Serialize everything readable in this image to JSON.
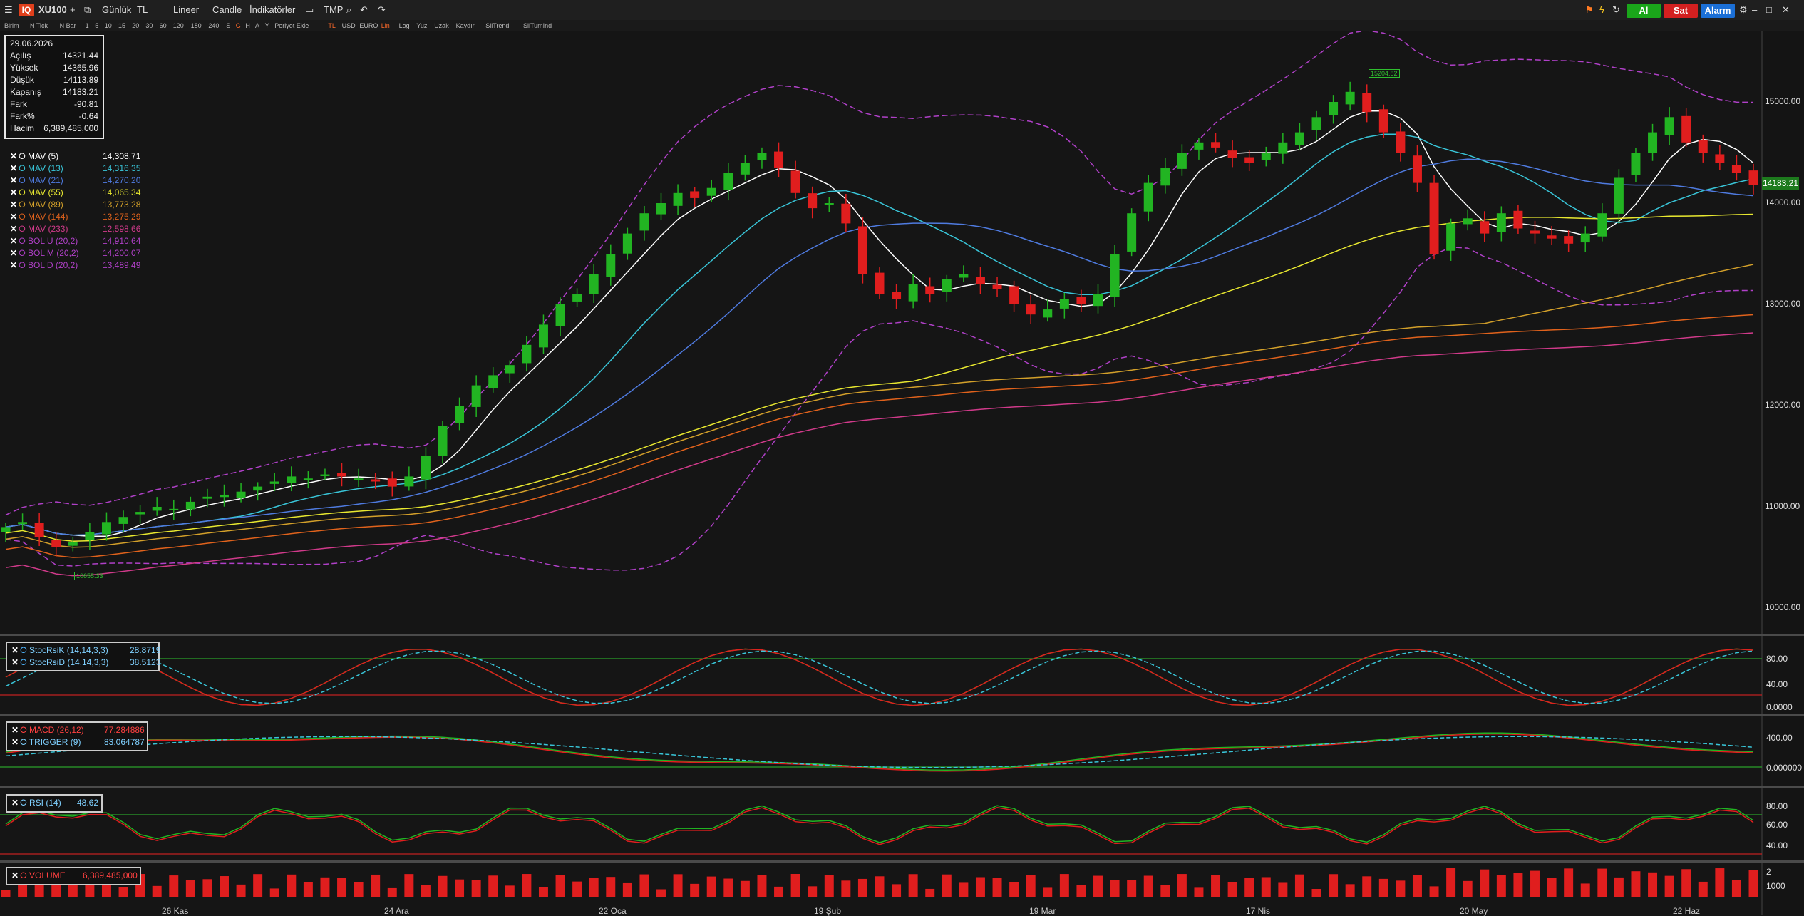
{
  "toolbar": {
    "menu_icon": "hamburger-menu-icon",
    "logo": "IQ",
    "symbol": "XU100",
    "add_symbol": "+",
    "period": "Günlük",
    "currency": "TL",
    "scale": "Lineer",
    "chart_type": "Candle",
    "indicators": "İndikatörler",
    "template": "TMP",
    "buy": "Al",
    "sell": "Sat",
    "alarm": "Alarm",
    "colors": {
      "buy": "#1aa61a",
      "sell": "#d42020",
      "alarm": "#1b6fd6",
      "logo": "#e1401c"
    }
  },
  "toolbar2": {
    "items": [
      "Birim",
      "N Tick",
      "N Bar",
      "1",
      "5",
      "10",
      "15",
      "20",
      "30",
      "60",
      "120",
      "180",
      "240",
      "S",
      "G",
      "H",
      "A",
      "Y",
      "Periyot Ekle",
      "TL",
      "USD",
      "EURO",
      "Lin",
      "Log",
      "Yuz",
      "Uzak",
      "Kaydır",
      "SilTrend",
      "SilTumInd"
    ],
    "highlighted": [
      "G",
      "Lin",
      "TL"
    ]
  },
  "info": {
    "date": "29.06.2026",
    "rows": [
      {
        "label": "Açılış",
        "value": "14321.44"
      },
      {
        "label": "Yüksek",
        "value": "14365.96"
      },
      {
        "label": "Düşük",
        "value": "14113.89"
      },
      {
        "label": "Kapanış",
        "value": "14183.21"
      },
      {
        "label": "Fark",
        "value": "-90.81"
      },
      {
        "label": "Fark%",
        "value": "-0.64"
      },
      {
        "label": "Hacim",
        "value": "6,389,485,000"
      }
    ]
  },
  "legend": [
    {
      "name": "MAV (5)",
      "value": "14,308.71",
      "color": "#ffffff"
    },
    {
      "name": "MAV (13)",
      "value": "14,316.35",
      "color": "#39c5d8"
    },
    {
      "name": "MAV (21)",
      "value": "14,270.20",
      "color": "#4f7be0"
    },
    {
      "name": "MAV (55)",
      "value": "14,065.34",
      "color": "#e8e830"
    },
    {
      "name": "MAV (89)",
      "value": "13,773.28",
      "color": "#d3a02a"
    },
    {
      "name": "MAV (144)",
      "value": "13,275.29",
      "color": "#e0621c"
    },
    {
      "name": "MAV (233)",
      "value": "12,598.66",
      "color": "#d03a8a"
    },
    {
      "name": "BOL U (20,2)",
      "value": "14,910.64",
      "color": "#b040c8"
    },
    {
      "name": "BOL M (20,2)",
      "value": "14,200.07",
      "color": "#b040c8"
    },
    {
      "name": "BOL D (20,2)",
      "value": "13,489.49",
      "color": "#b040c8"
    }
  ],
  "price_axis": {
    "ticks": [
      "15000.00",
      "14000.00",
      "13000.00",
      "12000.00",
      "11000.00",
      "10000.00"
    ],
    "last_price": "14183.21"
  },
  "annotations": {
    "high_label": "15204.82",
    "low_label": "10655.33"
  },
  "date_axis": [
    "26 Kas",
    "24 Ara",
    "22 Oca",
    "19 Şub",
    "19 Mar",
    "17 Nis",
    "20 May",
    "22 Haz"
  ],
  "stoch_rsi": {
    "k_name": "StocRsiK (14,14,3,3)",
    "k_value": "28.8719",
    "d_name": "StocRsiD (14,14,3,3)",
    "d_value": "38.5123",
    "ticks": [
      "80.00",
      "40.00",
      "0.0000"
    ]
  },
  "macd": {
    "macd_name": "MACD (26,12)",
    "macd_value": "77.284886",
    "trigger_name": "TRIGGER (9)",
    "trigger_value": "83.064787",
    "ticks": [
      "400.00",
      "0.000000"
    ]
  },
  "rsi": {
    "name": "RSI (14)",
    "value": "48.62",
    "ticks": [
      "80.00",
      "60.00",
      "40.00"
    ]
  },
  "volume": {
    "name": "VOLUME",
    "value": "6,389,485,000",
    "ticks": [
      "2",
      "1000"
    ]
  },
  "chart_data": {
    "type": "candlestick",
    "symbol": "XU100",
    "x": [
      "26 Kas",
      "24 Ara",
      "22 Oca",
      "19 Şub",
      "19 Mar",
      "17 Nis",
      "20 May",
      "22 Haz"
    ],
    "ylim": [
      10000,
      15600
    ],
    "close": [
      10800,
      10850,
      10700,
      10600,
      10650,
      10750,
      10850,
      10900,
      10950,
      11000,
      10980,
      11050,
      11100,
      11120,
      11150,
      11200,
      11250,
      11300,
      11280,
      11320,
      11300,
      11280,
      11250,
      11200,
      11300,
      11500,
      11800,
      12000,
      12200,
      12300,
      12400,
      12600,
      12800,
      13000,
      13100,
      13300,
      13500,
      13700,
      13900,
      14000,
      14100,
      14050,
      14150,
      14300,
      14400,
      14500,
      14350,
      14100,
      13950,
      14000,
      13800,
      13300,
      13100,
      13050,
      13200,
      13100,
      13250,
      13300,
      13200,
      13150,
      13000,
      12900,
      12950,
      13050,
      13000,
      13100,
      13500,
      13900,
      14200,
      14350,
      14500,
      14600,
      14550,
      14450,
      14400,
      14500,
      14600,
      14700,
      14850,
      15000,
      15100,
      14900,
      14700,
      14500,
      14200,
      13500,
      13800,
      13850,
      13700,
      13900,
      13750,
      13700,
      13650,
      13600,
      13700,
      13900,
      14250,
      14500,
      14700,
      14850,
      14600,
      14500,
      14400,
      14300,
      14183
    ]
  }
}
